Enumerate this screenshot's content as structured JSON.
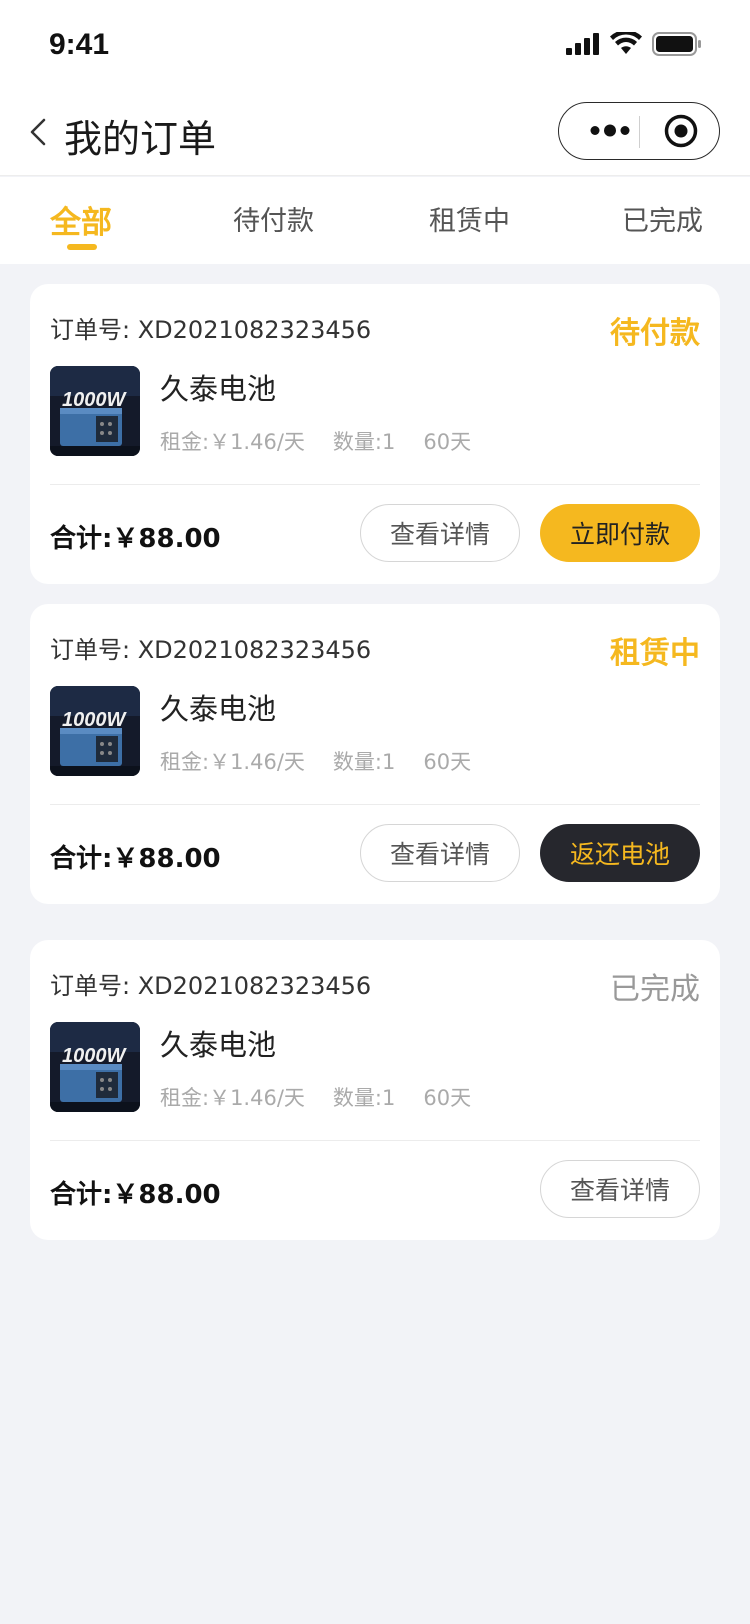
{
  "status_bar": {
    "time": "9:41"
  },
  "nav": {
    "title": "我的订单"
  },
  "tabs": [
    {
      "label": "全部",
      "active": true
    },
    {
      "label": "待付款",
      "active": false
    },
    {
      "label": "租赁中",
      "active": false
    },
    {
      "label": "已完成",
      "active": false
    }
  ],
  "colors": {
    "accent": "#f5b81f",
    "dark_button": "#26272d",
    "background": "#f2f3f7"
  },
  "orders": [
    {
      "order_label": "订单号:",
      "order_no": "XD2021082323456",
      "status": "待付款",
      "product_name": "久泰电池",
      "rent": "租金:￥1.46/天",
      "quantity": "数量:1",
      "days": "60天",
      "total": "合计:￥88.00",
      "detail_button": "查看详情",
      "action_button": "立即付款"
    },
    {
      "order_label": "订单号:",
      "order_no": "XD2021082323456",
      "status": "租赁中",
      "product_name": "久泰电池",
      "rent": "租金:￥1.46/天",
      "quantity": "数量:1",
      "days": "60天",
      "total": "合计:￥88.00",
      "detail_button": "查看详情",
      "action_button": "返还电池"
    },
    {
      "order_label": "订单号:",
      "order_no": "XD2021082323456",
      "status": "已完成",
      "product_name": "久泰电池",
      "rent": "租金:￥1.46/天",
      "quantity": "数量:1",
      "days": "60天",
      "total": "合计:￥88.00",
      "detail_button": "查看详情"
    }
  ],
  "product_image_text": "1000W"
}
